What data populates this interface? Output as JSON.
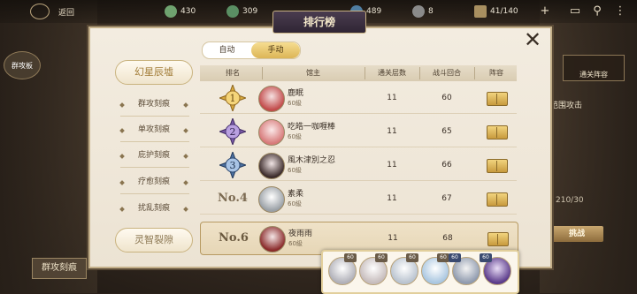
{
  "topbar": {
    "back_label": "返回",
    "resources": [
      {
        "icon": "diamond-icon",
        "value": "430"
      },
      {
        "icon": "potion-icon",
        "value": "309"
      },
      {
        "icon": "gem-icon",
        "value": "489"
      },
      {
        "icon": "coin-icon",
        "value": "8"
      },
      {
        "icon": "stamina-icon",
        "value": "41/140"
      }
    ]
  },
  "modal": {
    "title": "排行榜"
  },
  "categories": {
    "header": "幻星辰墟",
    "items": [
      "群攻刻痕",
      "单攻刻痕",
      "庇护刻痕",
      "疗愈刻痕",
      "扰乱刻痕"
    ],
    "bottom": "灵智裂隙"
  },
  "tabs": {
    "auto": "自动",
    "manual": "手动",
    "active": "manual"
  },
  "table": {
    "headers": [
      "排名",
      "馆主",
      "通关层数",
      "战斗回合",
      "阵容"
    ],
    "rows": [
      {
        "rank": "1",
        "name": "鹿眠",
        "level": "60級",
        "floors": "11",
        "turns": "60"
      },
      {
        "rank": "2",
        "name": "吃皓一咖喱棒",
        "level": "60級",
        "floors": "11",
        "turns": "65"
      },
      {
        "rank": "3",
        "name": "風木津別之忍",
        "level": "60級",
        "floors": "11",
        "turns": "66"
      },
      {
        "rank": "No.4",
        "name": "素柔",
        "level": "60級",
        "floors": "11",
        "turns": "67"
      }
    ],
    "my_row": {
      "rank": "No.6",
      "name": "夜雨雨",
      "level": "60級",
      "floors": "11",
      "turns": "68"
    }
  },
  "lineup": {
    "heroes": [
      {
        "level": "60"
      },
      {
        "level": "60"
      },
      {
        "level": "60"
      },
      {
        "level": "60"
      },
      {
        "level": "60"
      },
      {
        "level": "60"
      }
    ]
  },
  "right_panel": {
    "tab_label": "通关阵容",
    "text": "范围攻击",
    "count": "210/30",
    "button": "挑战"
  },
  "left_panel": {
    "bottom_button": "群攻刻痕",
    "tab_label": "群攻板"
  },
  "colors": {
    "gold": "#dcb556",
    "panel": "#f3ece0",
    "title_bg": "#3a2f42"
  }
}
